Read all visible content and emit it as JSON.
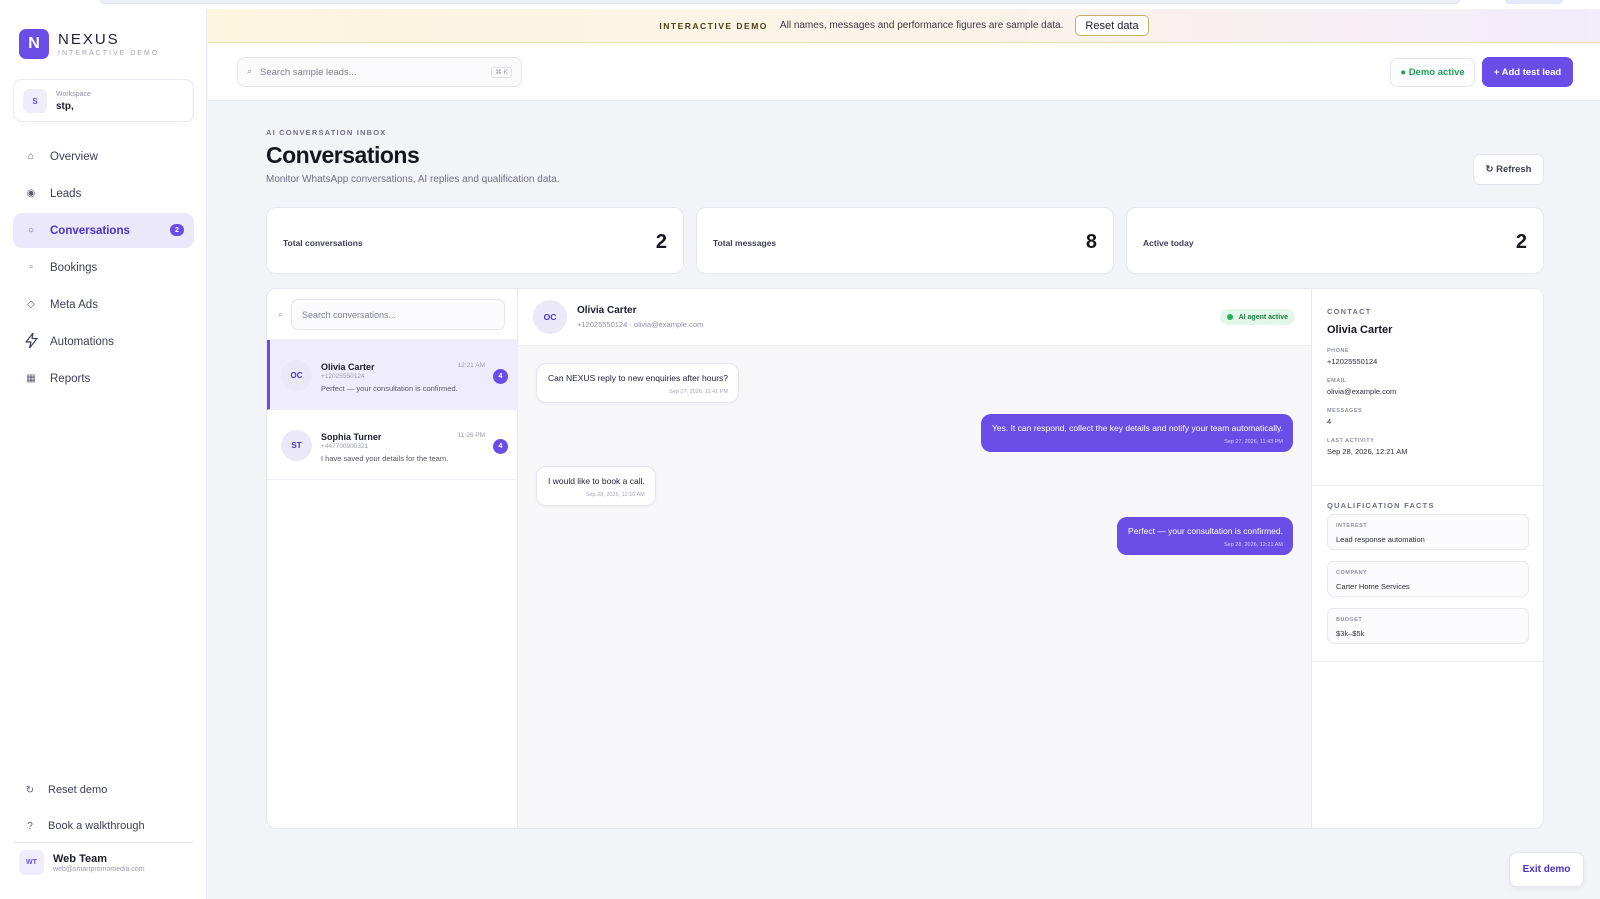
{
  "brand": {
    "logo_letter": "N",
    "name": "NEXUS",
    "subtitle": "INTERACTIVE DEMO",
    "accent": "#6a4de6"
  },
  "workspace": {
    "avatar": "S",
    "label": "Workspace",
    "name": "stp,"
  },
  "sidebar": {
    "items": [
      {
        "label": "Overview",
        "icon": "home-icon",
        "glyph": "⌂",
        "active": false
      },
      {
        "label": "Leads",
        "icon": "target-icon",
        "glyph": "◉",
        "active": false
      },
      {
        "label": "Conversations",
        "icon": "chat-bubble-icon",
        "glyph": "○",
        "active": true,
        "badge": "2"
      },
      {
        "label": "Bookings",
        "icon": "calendar-icon",
        "glyph": "▫",
        "active": false
      },
      {
        "label": "Meta Ads",
        "icon": "diamond-icon",
        "glyph": "◇",
        "active": false
      },
      {
        "label": "Automations",
        "icon": "lightning-icon",
        "glyph": "⚡",
        "active": false
      },
      {
        "label": "Reports",
        "icon": "table-icon",
        "glyph": "▦",
        "active": false
      }
    ],
    "bottom": [
      {
        "label": "Reset demo",
        "icon": "refresh-icon",
        "glyph": "↻"
      },
      {
        "label": "Book a walkthrough",
        "icon": "help-icon",
        "glyph": "?"
      }
    ],
    "user": {
      "avatar": "WT",
      "name": "Web Team",
      "email": "web@smartpromomedia.com"
    }
  },
  "banner": {
    "tag": "INTERACTIVE DEMO",
    "message": "All names, messages and performance figures are sample data.",
    "reset_label": "Reset data"
  },
  "topbar": {
    "search_placeholder": "Search sample leads...",
    "shortcut": "⌘ K",
    "demo_status": "● Demo active",
    "add_lead_label": "+ Add test lead"
  },
  "page": {
    "eyebrow": "AI CONVERSATION INBOX",
    "title": "Conversations",
    "subtitle": "Monitor WhatsApp conversations, AI replies and qualification data.",
    "refresh_label": "↻ Refresh"
  },
  "stats": [
    {
      "label": "Total conversations",
      "value": "2"
    },
    {
      "label": "Total messages",
      "value": "8"
    },
    {
      "label": "Active today",
      "value": "2"
    }
  ],
  "conversation_list": {
    "search_placeholder": "Search conversations...",
    "items": [
      {
        "initials": "OC",
        "name": "Olivia Carter",
        "phone": "+12025550124",
        "preview": "Perfect — your consultation is confirmed.",
        "time": "12:21 AM",
        "unread": "4",
        "selected": true
      },
      {
        "initials": "ST",
        "name": "Sophia Turner",
        "phone": "+447700900321",
        "preview": "I have saved your details for the team.",
        "time": "11:26 PM",
        "unread": "4",
        "selected": false
      }
    ]
  },
  "chat": {
    "initials": "OC",
    "name": "Olivia Carter",
    "meta": "+12025550124 · olivia@example.com",
    "status": "AI agent active",
    "messages": [
      {
        "direction": "in",
        "text": "Can NEXUS reply to new enquiries after hours?",
        "time": "Sep 27, 2026, 11:41 PM"
      },
      {
        "direction": "out",
        "text": "Yes. It can respond, collect the key details and notify your team automatically.",
        "time": "Sep 27, 2026, 11:43 PM"
      },
      {
        "direction": "in",
        "text": "I would like to book a call.",
        "time": "Sep 28, 2026, 12:16 AM"
      },
      {
        "direction": "out",
        "text": "Perfect — your consultation is confirmed.",
        "time": "Sep 28, 2026, 12:21 AM"
      }
    ]
  },
  "contact": {
    "eyebrow": "CONTACT",
    "name": "Olivia Carter",
    "fields": [
      {
        "label": "PHONE",
        "value": "+12025550124"
      },
      {
        "label": "EMAIL",
        "value": "olivia@example.com"
      },
      {
        "label": "MESSAGES",
        "value": "4"
      },
      {
        "label": "LAST ACTIVITY",
        "value": "Sep 28, 2026, 12:21 AM"
      }
    ],
    "facts_title": "QUALIFICATION FACTS",
    "facts": [
      {
        "label": "INTEREST",
        "value": "Lead response automation"
      },
      {
        "label": "COMPANY",
        "value": "Carter Home Services"
      },
      {
        "label": "BUDGET",
        "value": "$3k–$5k"
      }
    ]
  },
  "exit_demo_label": "Exit demo"
}
